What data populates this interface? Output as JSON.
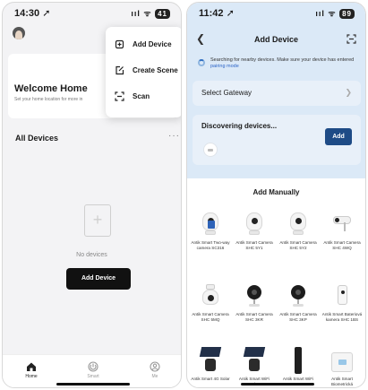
{
  "left": {
    "status": {
      "time": "14:30 ➚",
      "signal": "ııl ᯤ",
      "battery": "41"
    },
    "welcome": {
      "title": "Welcome Home",
      "subtitle": "Set your home location for more in"
    },
    "menu": [
      {
        "label": "Add Device",
        "icon": "device-plus-icon"
      },
      {
        "label": "Create Scene",
        "icon": "scene-edit-icon"
      },
      {
        "label": "Scan",
        "icon": "scan-icon"
      }
    ],
    "section_title": "All Devices",
    "more": "···",
    "empty_text": "No devices",
    "add_button": "Add Device",
    "tabs": [
      {
        "label": "Home",
        "icon": "home-icon",
        "active": true
      },
      {
        "label": "Smart",
        "icon": "smart-icon",
        "active": false
      },
      {
        "label": "Me",
        "icon": "profile-icon",
        "active": false
      }
    ]
  },
  "right": {
    "status": {
      "time": "11:42 ➚",
      "signal": "ııl ᯤ",
      "battery": "89"
    },
    "title": "Add Device",
    "search_text": "Searching for nearby devices. Make sure your device has entered",
    "search_link": "pairing mode",
    "gateway_label": "Select Gateway",
    "discover_label": "Discovering devices...",
    "discover_add": "Add",
    "add_manually": "Add Manually",
    "products": [
      {
        "name": "Antik Smart Two-way camera SC316",
        "shape": "cam-screen"
      },
      {
        "name": "Antik Smart Camera SHC 5Y1",
        "shape": "cam"
      },
      {
        "name": "Antik Smart Camera SHC 5Y2",
        "shape": "cam"
      },
      {
        "name": "Antik Smart Camera SHC 4WQ",
        "shape": "bullet"
      },
      {
        "name": "Antik Smart Camera SHC 5MQ",
        "shape": "cam-ctrl"
      },
      {
        "name": "Antik Smart Camera SHC 3KR",
        "shape": "dark"
      },
      {
        "name": "Antik Smart Camera SHC 3KP",
        "shape": "dark"
      },
      {
        "name": "Antik Smart Bateriová kamera SHC 1BS",
        "shape": "box"
      },
      {
        "name": "Antik Smart 4G Solar",
        "shape": "solar"
      },
      {
        "name": "Antik Smart WiFi Solar",
        "shape": "solar"
      },
      {
        "name": "Antik Smart WiFi",
        "shape": "tall"
      },
      {
        "name": "Antik Smart Biometrická",
        "shape": "scale"
      }
    ]
  }
}
